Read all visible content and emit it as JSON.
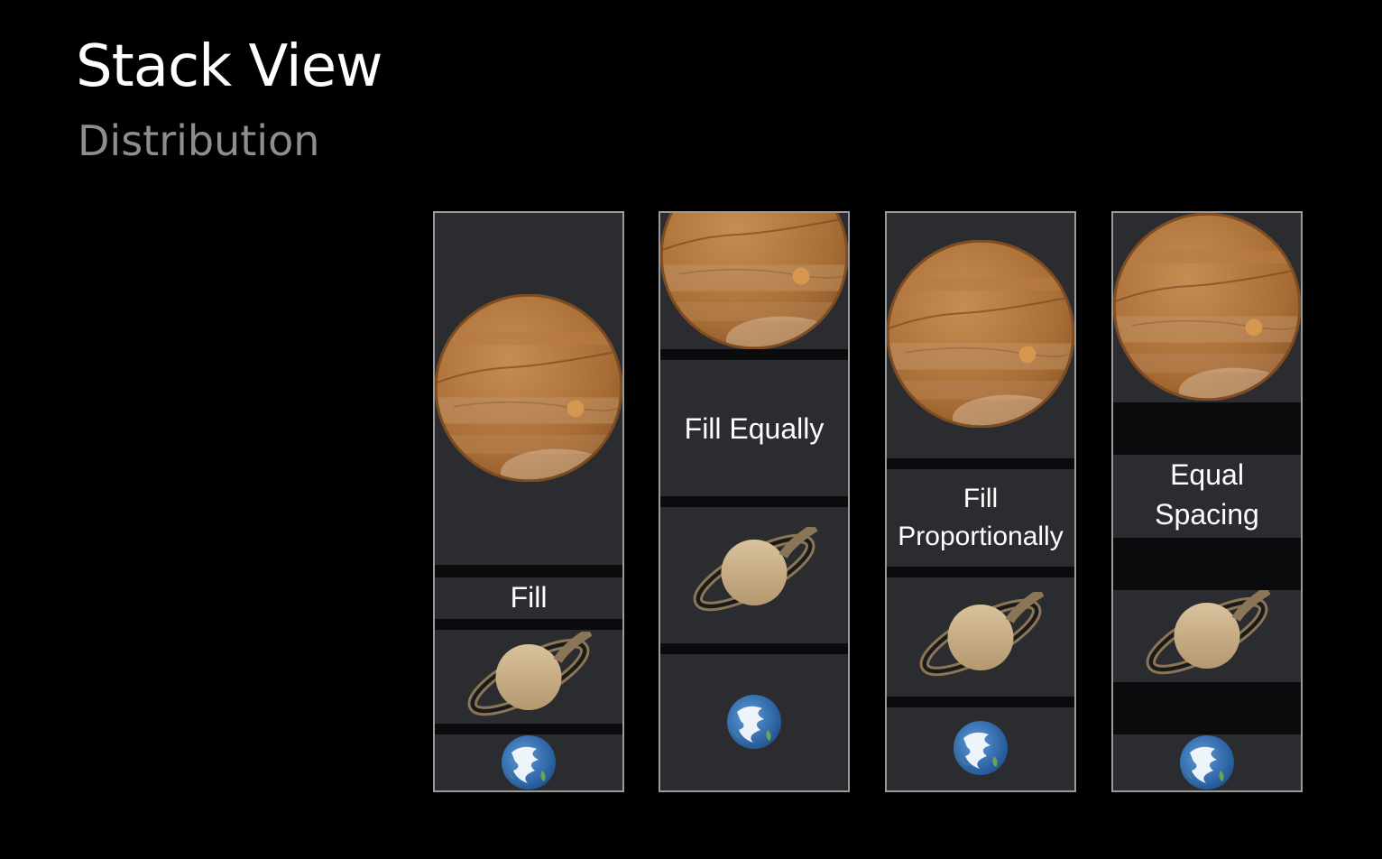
{
  "slide": {
    "title": "Stack View",
    "subtitle": "Distribution"
  },
  "panels": [
    {
      "label": "Fill"
    },
    {
      "label": "Fill Equally"
    },
    {
      "label_lines": [
        "Fill",
        "Proportionally"
      ]
    },
    {
      "label_lines": [
        "Equal",
        "Spacing"
      ]
    }
  ],
  "icons": [
    "jupiter-icon",
    "saturn-icon",
    "earth-icon"
  ],
  "colors": {
    "background": "#000000",
    "panel_border": "#9a9a9a",
    "segment": "#2a2c2f",
    "gap": "#0a0b0d",
    "subtitle": "#8e8e8e"
  }
}
